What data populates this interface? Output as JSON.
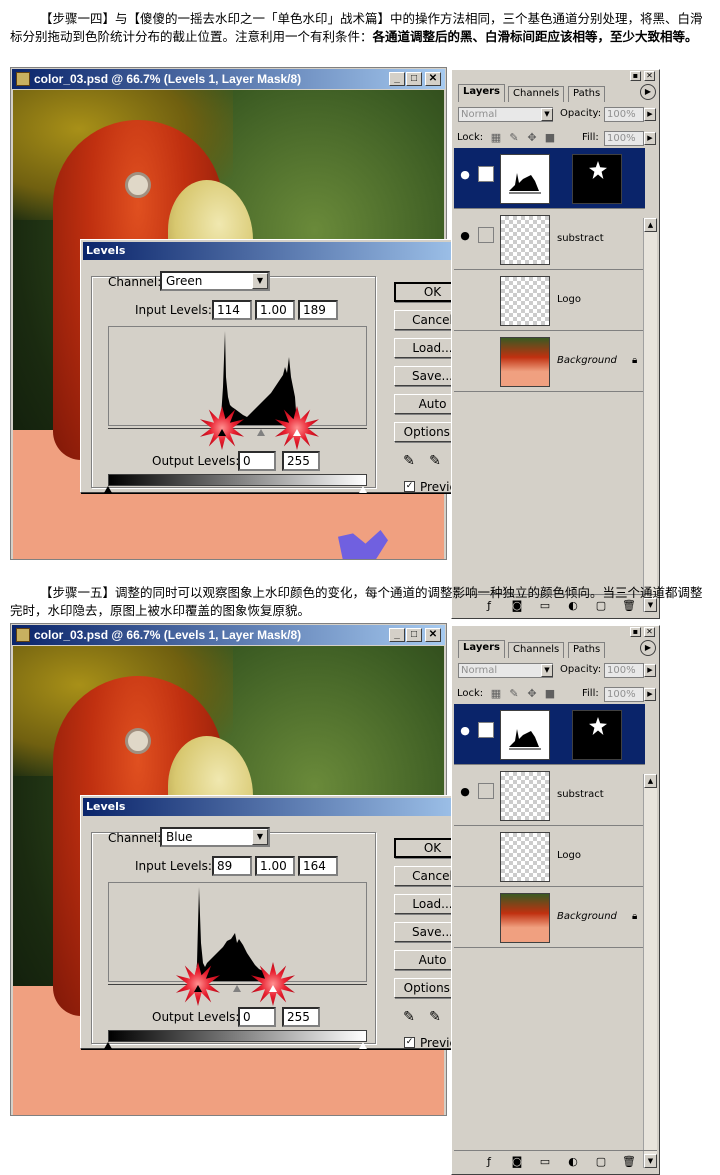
{
  "para1": {
    "plain": "【步骤一四】与【傻傻的一摇去水印之一「单色水印」战术篇】中的操作方法相同，三个基色通道分别处理，将黑、白滑标分别拖动到色阶统计分布的截止位置。注意利用一个有利条件：",
    "bold": "各通道调整后的黑、白滑标间距应该相等，至少大致相等。"
  },
  "para2": {
    "plain": "【步骤一五】调整的同时可以观察图象上水印颜色的变化，每个通道的调整影响一种独立的颜色倾向。当三个通道都调整完时，水印隐去，原图上被水印覆盖的图象恢复原貌。"
  },
  "shots": [
    {
      "window_title": "color_03.psd @ 66.7% (Levels 1, Layer Mask/8)",
      "levels_title": "Levels",
      "channel_label": "Channel:",
      "channel_value": "Green",
      "input_label": "Input Levels:",
      "input_black": "114",
      "input_gamma": "1.00",
      "input_white": "189",
      "output_label": "Output Levels:",
      "output_black": "0",
      "output_white": "255",
      "buttons": [
        "OK",
        "Cancel",
        "Load...",
        "Save...",
        "Auto",
        "Options..."
      ],
      "preview_label": "Preview",
      "preview_checked": true
    },
    {
      "window_title": "color_03.psd @ 66.7% (Levels 1, Layer Mask/8)",
      "levels_title": "Levels",
      "channel_label": "Channel:",
      "channel_value": "Blue",
      "input_label": "Input Levels:",
      "input_black": "89",
      "input_gamma": "1.00",
      "input_white": "164",
      "output_label": "Output Levels:",
      "output_black": "0",
      "output_white": "255",
      "buttons": [
        "OK",
        "Cancel",
        "Load...",
        "Save...",
        "Auto",
        "Options..."
      ],
      "preview_label": "Preview",
      "preview_checked": true
    }
  ],
  "layers_panel": {
    "tabs": [
      "Layers",
      "Channels",
      "Paths"
    ],
    "active_tab": "Layers",
    "blend_mode": "Normal",
    "opacity_label": "Opacity:",
    "opacity_value": "100%",
    "lock_label": "Lock:",
    "fill_label": "Fill:",
    "fill_value": "100%",
    "layers": [
      {
        "name": "",
        "selected": true,
        "visible": true
      },
      {
        "name": "substract",
        "selected": false,
        "visible": true
      },
      {
        "name": "Logo",
        "selected": false,
        "visible": false
      },
      {
        "name": "Background",
        "selected": false,
        "visible": false,
        "locked": true
      }
    ]
  },
  "colors": {
    "title_bar": "#0a246a",
    "highlight_burst": "#e82030",
    "dialog_bg": "#d4d0c8"
  }
}
